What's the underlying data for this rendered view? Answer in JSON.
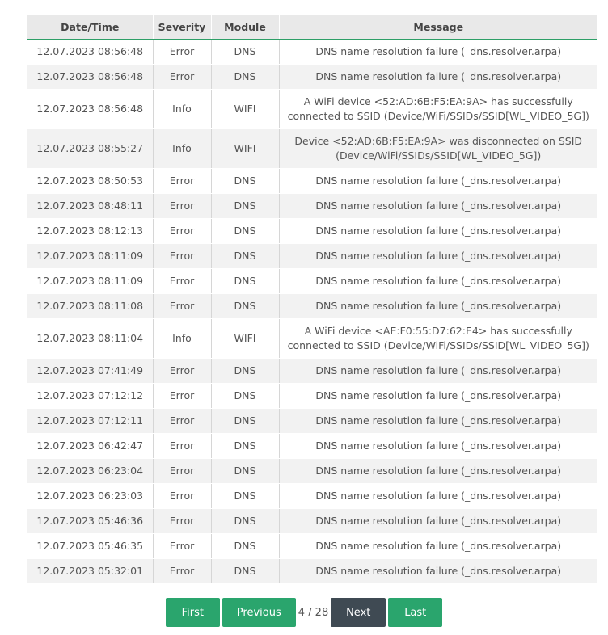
{
  "table": {
    "headers": {
      "datetime": "Date/Time",
      "severity": "Severity",
      "module": "Module",
      "message": "Message"
    },
    "rows": [
      {
        "datetime": "12.07.2023 08:56:48",
        "severity": "Error",
        "module": "DNS",
        "message": "DNS name resolution failure (_dns.resolver.arpa)"
      },
      {
        "datetime": "12.07.2023 08:56:48",
        "severity": "Error",
        "module": "DNS",
        "message": "DNS name resolution failure (_dns.resolver.arpa)"
      },
      {
        "datetime": "12.07.2023 08:56:48",
        "severity": "Info",
        "module": "WIFI",
        "message": "A WiFi device <52:AD:6B:F5:EA:9A> has successfully connected to SSID (Device/WiFi/SSIDs/SSID[WL_VIDEO_5G])"
      },
      {
        "datetime": "12.07.2023 08:55:27",
        "severity": "Info",
        "module": "WIFI",
        "message": "Device <52:AD:6B:F5:EA:9A> was disconnected on SSID (Device/WiFi/SSIDs/SSID[WL_VIDEO_5G])"
      },
      {
        "datetime": "12.07.2023 08:50:53",
        "severity": "Error",
        "module": "DNS",
        "message": "DNS name resolution failure (_dns.resolver.arpa)"
      },
      {
        "datetime": "12.07.2023 08:48:11",
        "severity": "Error",
        "module": "DNS",
        "message": "DNS name resolution failure (_dns.resolver.arpa)"
      },
      {
        "datetime": "12.07.2023 08:12:13",
        "severity": "Error",
        "module": "DNS",
        "message": "DNS name resolution failure (_dns.resolver.arpa)"
      },
      {
        "datetime": "12.07.2023 08:11:09",
        "severity": "Error",
        "module": "DNS",
        "message": "DNS name resolution failure (_dns.resolver.arpa)"
      },
      {
        "datetime": "12.07.2023 08:11:09",
        "severity": "Error",
        "module": "DNS",
        "message": "DNS name resolution failure (_dns.resolver.arpa)"
      },
      {
        "datetime": "12.07.2023 08:11:08",
        "severity": "Error",
        "module": "DNS",
        "message": "DNS name resolution failure (_dns.resolver.arpa)"
      },
      {
        "datetime": "12.07.2023 08:11:04",
        "severity": "Info",
        "module": "WIFI",
        "message": "A WiFi device <AE:F0:55:D7:62:E4> has successfully connected to SSID (Device/WiFi/SSIDs/SSID[WL_VIDEO_5G])"
      },
      {
        "datetime": "12.07.2023 07:41:49",
        "severity": "Error",
        "module": "DNS",
        "message": "DNS name resolution failure (_dns.resolver.arpa)"
      },
      {
        "datetime": "12.07.2023 07:12:12",
        "severity": "Error",
        "module": "DNS",
        "message": "DNS name resolution failure (_dns.resolver.arpa)"
      },
      {
        "datetime": "12.07.2023 07:12:11",
        "severity": "Error",
        "module": "DNS",
        "message": "DNS name resolution failure (_dns.resolver.arpa)"
      },
      {
        "datetime": "12.07.2023 06:42:47",
        "severity": "Error",
        "module": "DNS",
        "message": "DNS name resolution failure (_dns.resolver.arpa)"
      },
      {
        "datetime": "12.07.2023 06:23:04",
        "severity": "Error",
        "module": "DNS",
        "message": "DNS name resolution failure (_dns.resolver.arpa)"
      },
      {
        "datetime": "12.07.2023 06:23:03",
        "severity": "Error",
        "module": "DNS",
        "message": "DNS name resolution failure (_dns.resolver.arpa)"
      },
      {
        "datetime": "12.07.2023 05:46:36",
        "severity": "Error",
        "module": "DNS",
        "message": "DNS name resolution failure (_dns.resolver.arpa)"
      },
      {
        "datetime": "12.07.2023 05:46:35",
        "severity": "Error",
        "module": "DNS",
        "message": "DNS name resolution failure (_dns.resolver.arpa)"
      },
      {
        "datetime": "12.07.2023 05:32:01",
        "severity": "Error",
        "module": "DNS",
        "message": "DNS name resolution failure (_dns.resolver.arpa)"
      }
    ]
  },
  "pagination": {
    "first_label": "First",
    "previous_label": "Previous",
    "current_page": "4",
    "total_pages": "28",
    "indicator": "4 / 28",
    "next_label": "Next",
    "last_label": "Last"
  },
  "colors": {
    "accent_green": "#2aa56d",
    "button_dark": "#3f4a53",
    "header_bg": "#e9e9e9",
    "header_rule": "#2e9f67",
    "row_alt_bg": "#f2f2f2"
  }
}
